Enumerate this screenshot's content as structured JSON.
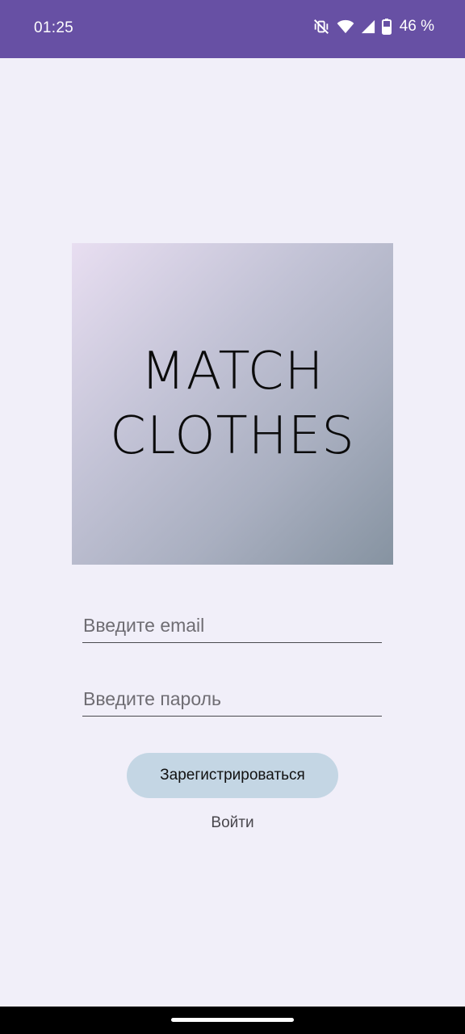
{
  "status_bar": {
    "time": "01:25",
    "battery_percent": "46 %",
    "icons": [
      "vibrate-off-icon",
      "wifi-icon",
      "signal-icon",
      "battery-icon"
    ],
    "background": "#6750a4"
  },
  "logo": {
    "line1": "MATCH",
    "line2": "CLOTHES"
  },
  "form": {
    "email_placeholder": "Введите email",
    "password_placeholder": "Введите пароль",
    "register_label": "Зарегистрироваться",
    "login_label": "Войти"
  },
  "colors": {
    "page_background": "#f1eff9",
    "register_button": "#c4d6e4"
  }
}
